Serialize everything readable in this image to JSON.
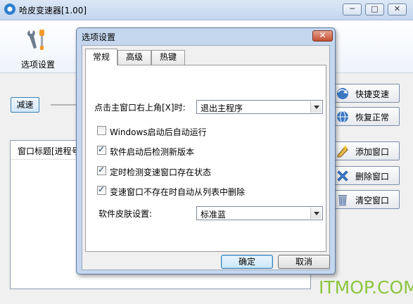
{
  "window": {
    "title": "哈皮变速器[1.00]",
    "min_glyph": "─",
    "max_glyph": "□",
    "close_glyph": "✕"
  },
  "toolbar": {
    "options_label": "选项设置"
  },
  "controls": {
    "slow_label": "减速"
  },
  "list": {
    "header": "窗口标题[进程号"
  },
  "side_buttons": [
    {
      "label": "快捷变速",
      "icon": "globe-arrow-icon"
    },
    {
      "label": "恢复正常",
      "icon": "globe-icon"
    },
    {
      "label": "添加窗口",
      "icon": "add-window-icon"
    },
    {
      "label": "删除窗口",
      "icon": "delete-x-icon"
    },
    {
      "label": "清空窗口",
      "icon": "trash-icon"
    }
  ],
  "dialog": {
    "title": "选项设置",
    "close_glyph": "✕",
    "tabs": [
      "常规",
      "高级",
      "热键"
    ],
    "active_tab": "常规",
    "close_action_label": "点击主窗口右上角[X]时:",
    "close_action_value": "退出主程序",
    "checkboxes": [
      {
        "label": "Windows启动后自动运行",
        "checked": false
      },
      {
        "label": "软件启动后检测新版本",
        "checked": true
      },
      {
        "label": "定时检测变速窗口存在状态",
        "checked": true
      },
      {
        "label": "变速窗口不存在时自动从列表中删除",
        "checked": true
      }
    ],
    "skin_label": "软件皮肤设置:",
    "skin_value": "标准蓝",
    "ok_label": "确定",
    "cancel_label": "取消"
  },
  "watermark": "ITMOP.COM",
  "colors": {
    "accent": "#3c7fb1",
    "title_bar": "#c4d6ee",
    "watermark": "#8cc63f",
    "close": "#c44f32"
  }
}
